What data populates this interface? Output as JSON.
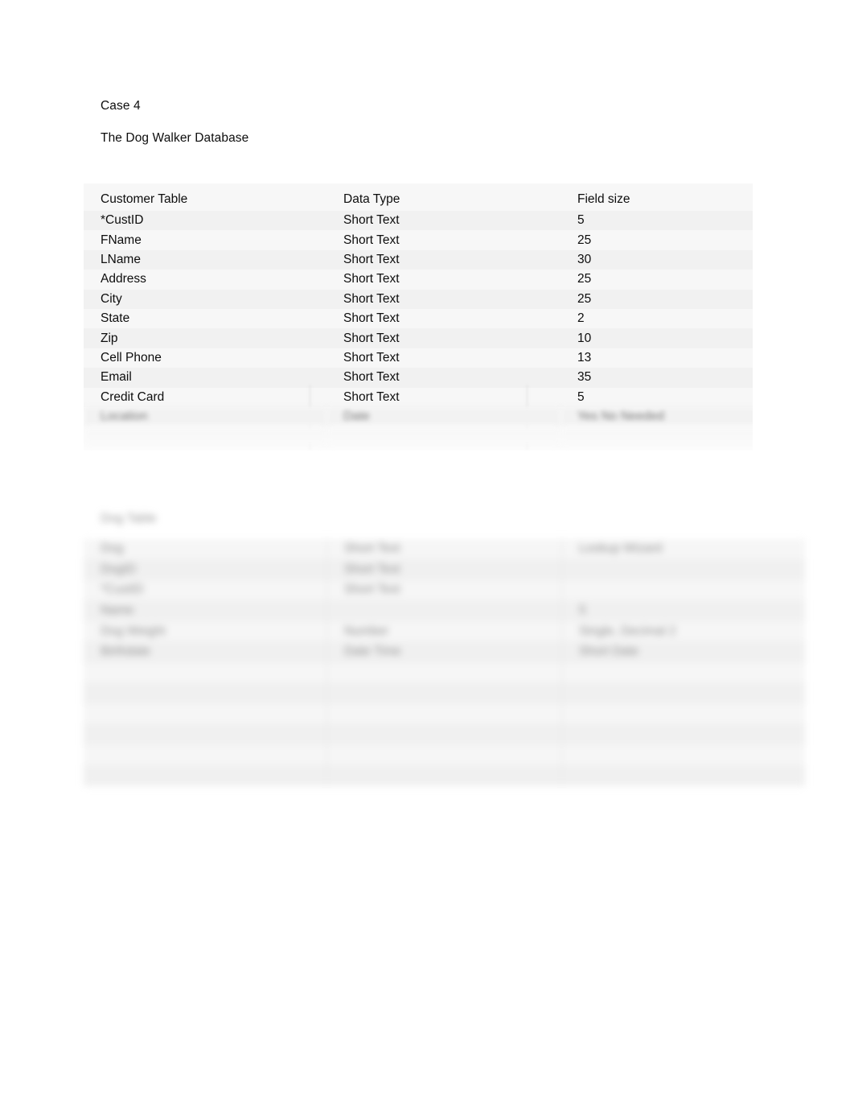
{
  "document": {
    "heading": {
      "line1": "Case 4",
      "line2": "The Dog Walker Database"
    }
  },
  "customer_table": {
    "header": {
      "c1": "Customer Table",
      "c2": "Data Type",
      "c3": "Field size"
    },
    "rows": [
      {
        "c1": "*CustID",
        "c2": "Short Text",
        "c3": "5",
        "redacted": false
      },
      {
        "c1": "FName",
        "c2": "Short Text",
        "c3": "25",
        "redacted": false
      },
      {
        "c1": "LName",
        "c2": "Short Text",
        "c3": "30",
        "redacted": false
      },
      {
        "c1": "Address",
        "c2": "Short Text",
        "c3": "25",
        "redacted": false
      },
      {
        "c1": "City",
        "c2": "Short Text",
        "c3": "25",
        "redacted": false
      },
      {
        "c1": "State",
        "c2": "Short Text",
        "c3": "2",
        "redacted": false
      },
      {
        "c1": "Zip",
        "c2": "Short Text",
        "c3": "10",
        "redacted": false
      },
      {
        "c1": "Cell Phone",
        "c2": "Short Text",
        "c3": "13",
        "redacted": false
      },
      {
        "c1": "Email",
        "c2": "Short Text",
        "c3": "35",
        "redacted": false
      },
      {
        "c1": "Credit Card",
        "c2": "Short Text",
        "c3": "5",
        "redacted": false
      },
      {
        "c1": "Location",
        "c2": "Date",
        "c3": "Yes No Needed",
        "redacted": true
      },
      {
        "c1": "",
        "c2": "",
        "c3": "",
        "redacted": true
      }
    ]
  },
  "second_table": {
    "caption": "Dog Table",
    "rows": [
      {
        "c1": "Dog",
        "c2": "Short Text",
        "c3": "Lookup Wizard",
        "empty": false
      },
      {
        "c1": "DogID",
        "c2": "Short Text",
        "c3": "",
        "empty": false
      },
      {
        "c1": "*CustID",
        "c2": "Short Text",
        "c3": "",
        "empty": false
      },
      {
        "c1": "Name",
        "c2": "",
        "c3": "5",
        "empty": false
      },
      {
        "c1": "Dog Weight",
        "c2": "Number",
        "c3": "Single, Decimal 2",
        "empty": false
      },
      {
        "c1": "Birthdate",
        "c2": "Date Time",
        "c3": "Short Date",
        "empty": false
      },
      {
        "c1": "",
        "c2": "",
        "c3": "",
        "empty": true
      },
      {
        "c1": "",
        "c2": "",
        "c3": "",
        "empty": true
      },
      {
        "c1": "",
        "c2": "",
        "c3": "",
        "empty": true
      },
      {
        "c1": "",
        "c2": "",
        "c3": "",
        "empty": true
      },
      {
        "c1": "",
        "c2": "",
        "c3": "",
        "empty": true
      },
      {
        "c1": "",
        "c2": "",
        "c3": "",
        "empty": true
      }
    ]
  }
}
